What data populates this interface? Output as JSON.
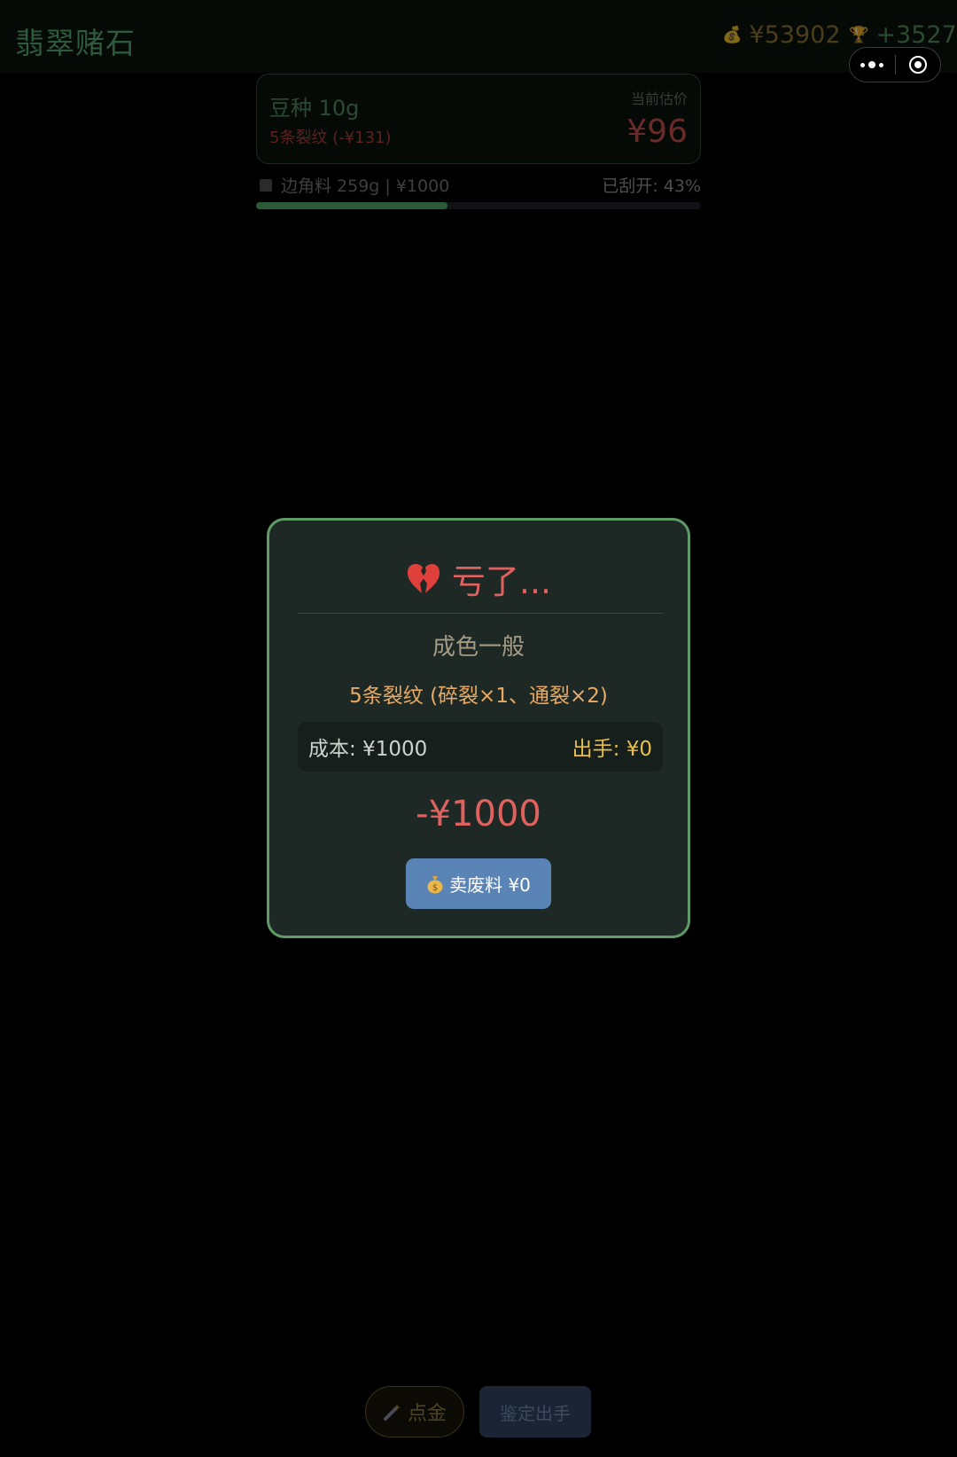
{
  "header": {
    "title": "翡翠赌石",
    "money_icon": "money-bag-icon",
    "money": "¥53902",
    "trophy_icon": "trophy-icon",
    "profit": "+3527"
  },
  "stone": {
    "name": "豆种 10g",
    "cracks": "5条裂纹 (-¥131)",
    "estimate_label": "当前估价",
    "estimate_value": "¥96",
    "material": "边角料 259g | ¥1000",
    "opened": "已刮开: 43%",
    "opened_progress": 0.43
  },
  "result": {
    "title": "亏了...",
    "title_icon": "broken-heart-icon",
    "quality": "成色一般",
    "cracks_detail": "5条裂纹 (碎裂×1、通裂×2)",
    "cost": "成本: ¥1000",
    "sold": "出手: ¥0",
    "net": "-¥1000",
    "scrap_button_label": "卖废料 ¥0"
  },
  "actions": {
    "gold_label": "点金",
    "appraise_label": "鉴定出手"
  },
  "colors": {
    "modal_border": "#5f9b66",
    "loss_red": "#e0625e",
    "crack_orange": "#e8aa64",
    "sold_yellow": "#e6c04a",
    "button_blue": "#5b84b6"
  }
}
